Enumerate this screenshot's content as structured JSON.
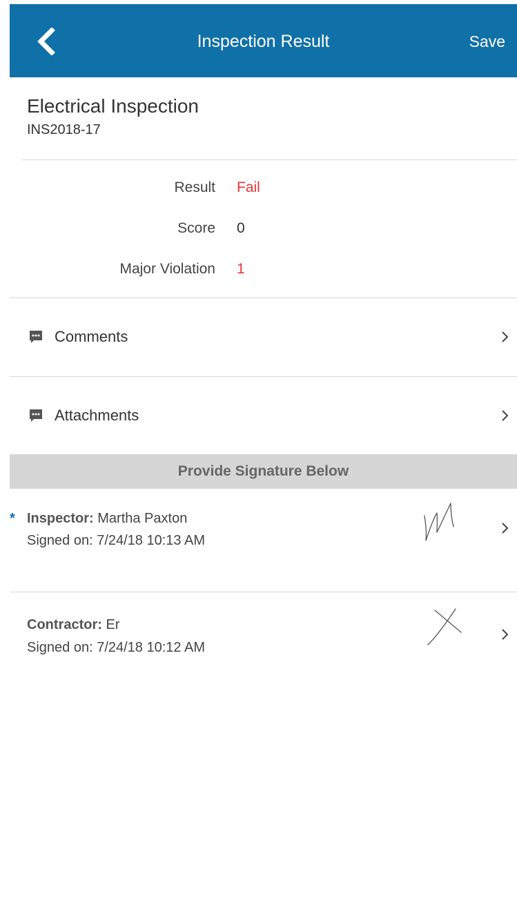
{
  "header": {
    "title": "Inspection Result",
    "save_label": "Save",
    "back_icon": "chevron-left-icon",
    "background_color": "#1070a8"
  },
  "inspection": {
    "type": "Electrical Inspection",
    "id": "INS2018-17"
  },
  "results": [
    {
      "label": "Result",
      "value": "Fail",
      "value_color": "#e8343a"
    },
    {
      "label": "Score",
      "value": "0",
      "value_color": "#333333"
    },
    {
      "label": "Major Violation",
      "value": "1",
      "value_color": "#e8343a"
    }
  ],
  "nav": {
    "comments": {
      "label": "Comments",
      "icon": "comment-icon"
    },
    "attachments": {
      "label": "Attachments",
      "icon": "comment-icon"
    }
  },
  "signatures": {
    "section_title": "Provide Signature Below",
    "inspector": {
      "required_mark": "*",
      "role_label": "Inspector:",
      "name": "Martha Paxton",
      "signed_on": "Signed on: 7/24/18 10:13 AM"
    },
    "contractor": {
      "role_label": "Contractor:",
      "name": "Er",
      "signed_on": "Signed on: 7/24/18 10:12 AM"
    }
  }
}
